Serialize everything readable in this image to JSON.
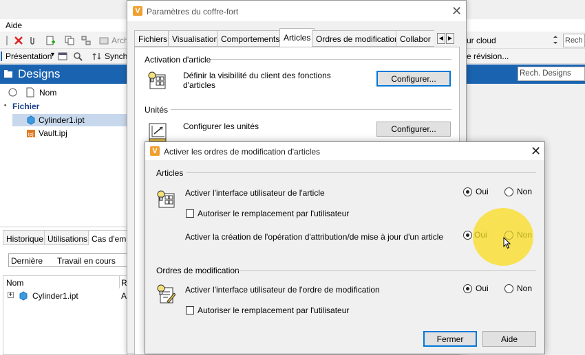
{
  "background_app": {
    "menu": {
      "help": "Aide"
    },
    "toolbar1": {
      "archive_partial": "Arch",
      "cloud_partial": "ur cloud",
      "search_partial": "Rech"
    },
    "toolbar2": {
      "view_label": "Présentation",
      "sync_partial": "Synch",
      "revision_partial": "e révision..."
    },
    "designs": {
      "title": "Designs",
      "search_placeholder": "Rech. Designs"
    },
    "tree": {
      "column_name": "Nom",
      "group": "Fichier",
      "files": [
        "Cylinder1.ipt",
        "Vault.ipj"
      ]
    },
    "lower": {
      "tabs": [
        "Historique",
        "Utilisations",
        "Cas d'emp"
      ],
      "version_filter": "Dernière",
      "state_filter": "Travail en cours",
      "col_name": "Nom",
      "col_r": "R",
      "row_name": "Cylinder1.ipt",
      "row_r": "A"
    }
  },
  "vault_settings": {
    "title": "Paramètres du coffre-fort",
    "tabs": [
      "Fichiers",
      "Visualisation",
      "Comportements",
      "Articles",
      "Ordres de modification",
      "Collabor"
    ],
    "active_tab": "Articles",
    "item_activation": {
      "heading": "Activation d'article",
      "description": "Définir la visibilité du client des fonctions d'articles",
      "button": "Configurer..."
    },
    "units": {
      "heading": "Unités",
      "description": "Configurer les unités",
      "button": "Configurer..."
    }
  },
  "enable_dialog": {
    "title": "Activer les ordres de modification d'articles",
    "articles": {
      "heading": "Articles",
      "enable_ui": {
        "label": "Activer l'interface utilisateur de l'article",
        "yes": "Oui",
        "no": "Non",
        "selected": "Oui"
      },
      "allow_override": {
        "label": "Autoriser le remplacement par l'utilisateur",
        "checked": false
      },
      "enable_assign": {
        "label": "Activer la création de l'opération d'attribution/de mise à jour d'un article",
        "yes": "Oui",
        "no": "Non",
        "selected": "Oui"
      }
    },
    "change_orders": {
      "heading": "Ordres de modification",
      "enable_ui": {
        "label": "Activer l'interface utilisateur de l'ordre de modification",
        "yes": "Oui",
        "no": "Non",
        "selected": "Oui"
      },
      "allow_override": {
        "label": "Autoriser le remplacement par l'utilisateur",
        "checked": false
      }
    },
    "buttons": {
      "close": "Fermer",
      "help": "Aide"
    }
  },
  "colors": {
    "accent_blue": "#1a63b0",
    "highlight": "#fade28",
    "focus_border": "#0078d7",
    "logo": "#f0a030"
  }
}
